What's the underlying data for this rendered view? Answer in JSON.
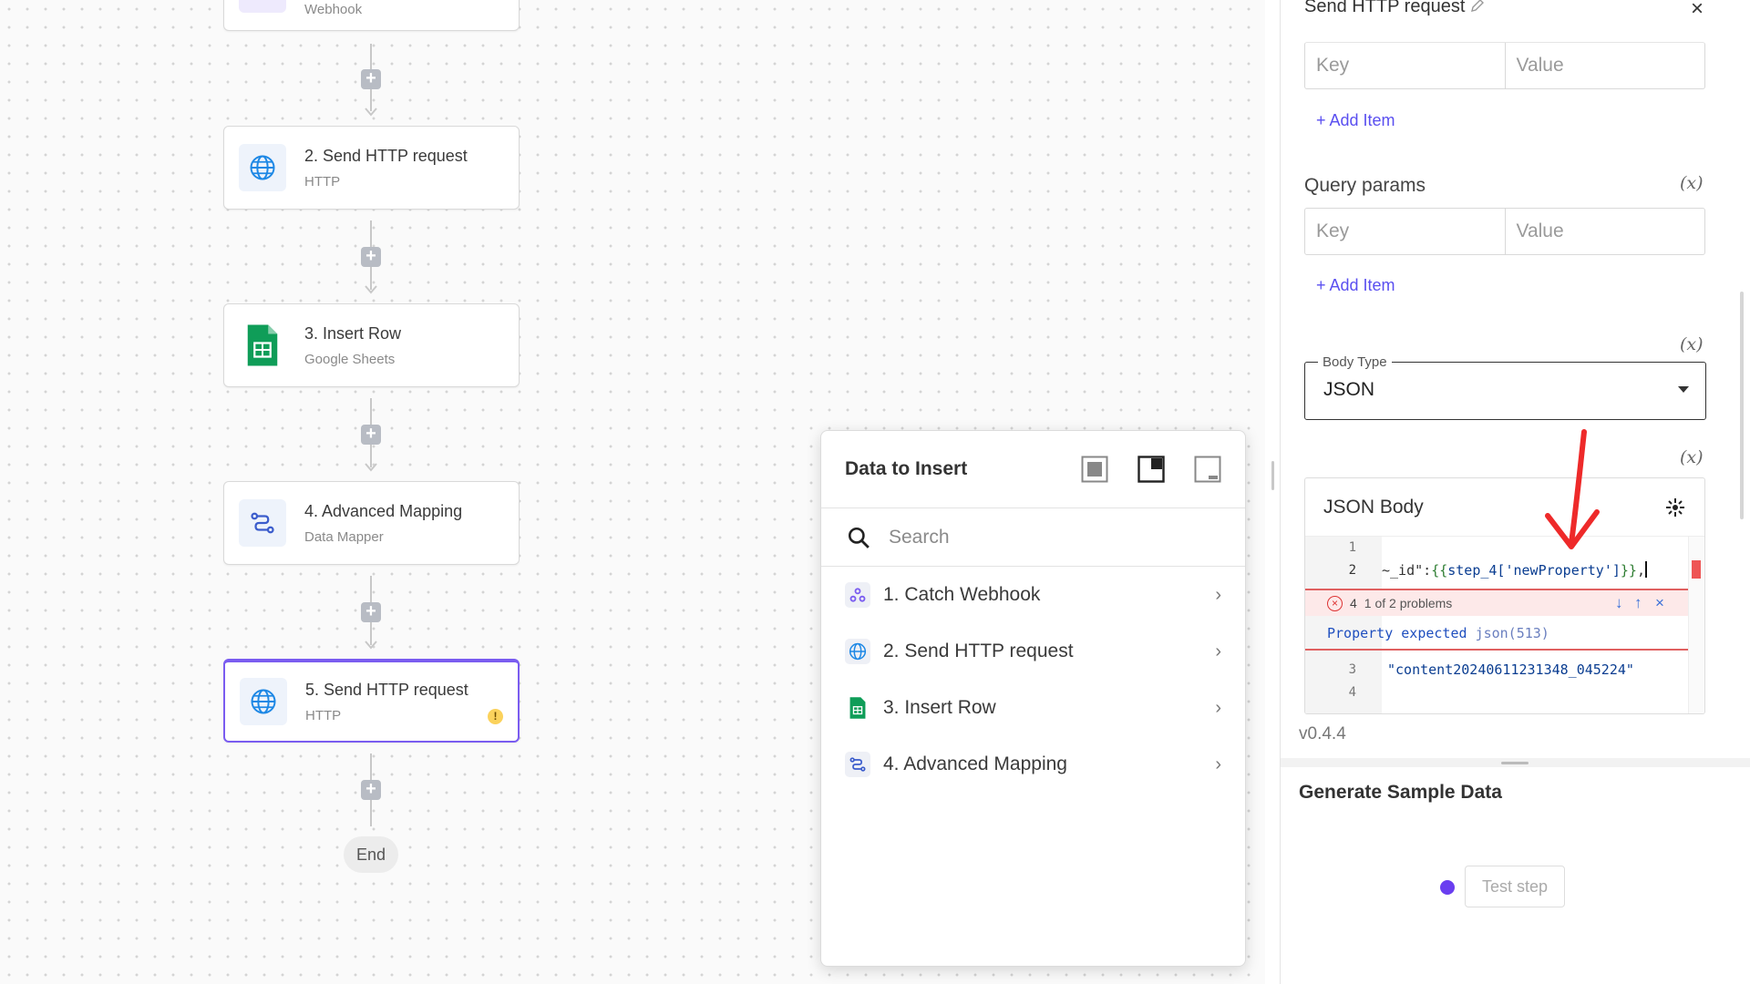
{
  "flow": {
    "steps": [
      {
        "title": "",
        "subtitle": "Webhook"
      },
      {
        "title": "2. Send HTTP request",
        "subtitle": "HTTP"
      },
      {
        "title": "3. Insert Row",
        "subtitle": "Google Sheets"
      },
      {
        "title": "4. Advanced Mapping",
        "subtitle": "Data Mapper"
      },
      {
        "title": "5. Send HTTP request",
        "subtitle": "HTTP",
        "warning": "!"
      }
    ],
    "add_symbol": "+",
    "end_label": "End"
  },
  "data_panel": {
    "title": "Data to Insert",
    "search_placeholder": "Search",
    "items": [
      {
        "label": "1. Catch Webhook",
        "icon": "webhook-icon"
      },
      {
        "label": "2. Send HTTP request",
        "icon": "globe-icon"
      },
      {
        "label": "3. Insert Row",
        "icon": "google-sheets-icon"
      },
      {
        "label": "4. Advanced Mapping",
        "icon": "mapping-icon"
      }
    ],
    "chevron": "›"
  },
  "right_panel": {
    "title": "Send HTTP request",
    "close": "×",
    "headers_row": {
      "key_placeholder": "Key",
      "value_placeholder": "Value"
    },
    "add_item_1": "+ Add Item",
    "query_params_label": "Query params",
    "query_row": {
      "key_placeholder": "Key",
      "value_placeholder": "Value"
    },
    "add_item_2": "+ Add Item",
    "var_symbol": "(x)",
    "body_type": {
      "legend": "Body Type",
      "value": "JSON"
    },
    "json_body": {
      "title": "JSON Body",
      "lines": [
        {
          "number": "1",
          "text": ""
        },
        {
          "number": "2",
          "pre": "~_id\":",
          "open": "{{",
          "expr": "step_4['newProperty']",
          "close": "}}",
          "post": ","
        },
        {
          "number": "3",
          "text": "\"content20240611231348_045224\""
        },
        {
          "number": "4",
          "text": ""
        }
      ],
      "problem_count": "4",
      "problem_nav": "1 of 2 problems",
      "problem_message": "Property expected",
      "problem_hint": "json(513)"
    },
    "version": "v0.4.4",
    "generate_title": "Generate Sample Data",
    "test_step_label": "Test step"
  },
  "colors": {
    "accent": "#7a5cf0",
    "link": "#5a4ff0",
    "error": "#e06060",
    "annotation_arrow": "#ee2a2a"
  }
}
